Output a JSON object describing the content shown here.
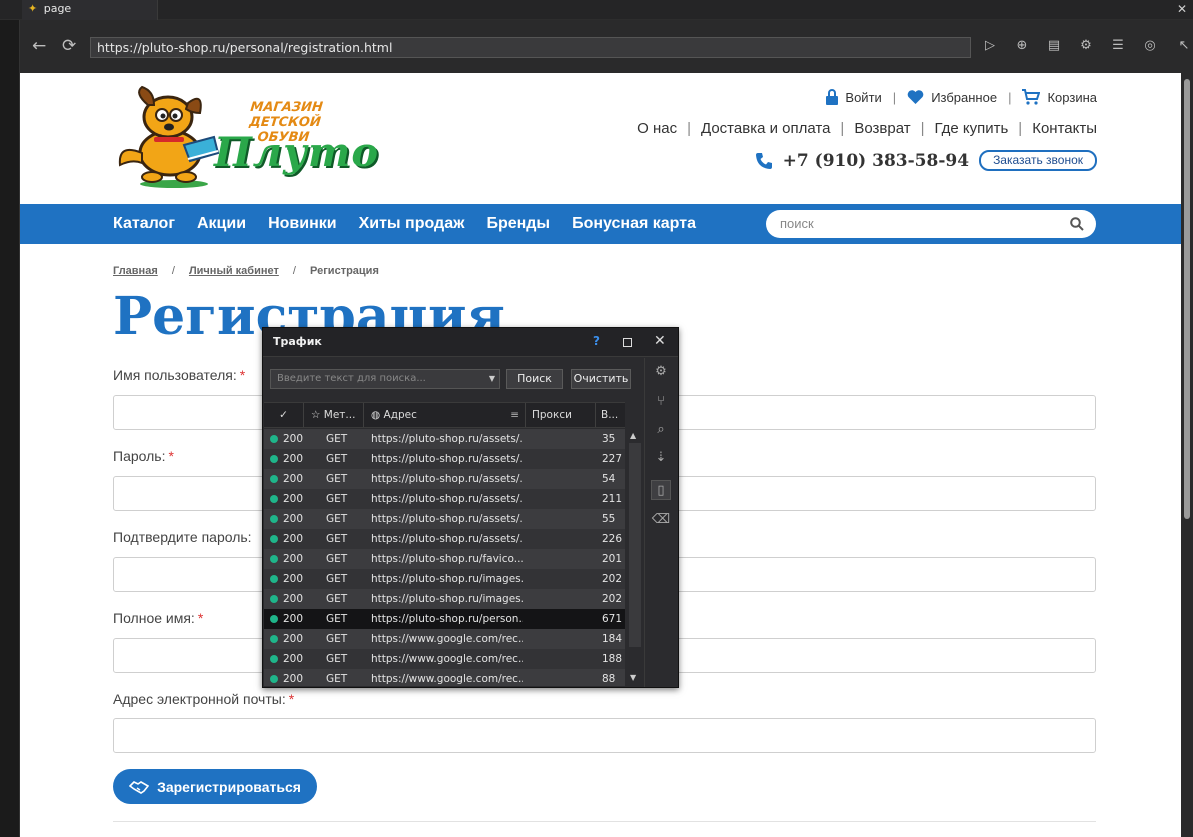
{
  "browser": {
    "tab_title": "page",
    "url": "https://pluto-shop.ru/personal/registration.html"
  },
  "site": {
    "logo_caption": "МАГАЗИН ДЕТСКОЙ ОБУВИ",
    "logo_brand": "Плуто",
    "top_links": {
      "login": "Войти",
      "favorites": "Избранное",
      "cart": "Корзина"
    },
    "menu": [
      "О нас",
      "Доставка и оплата",
      "Возврат",
      "Где купить",
      "Контакты"
    ],
    "phone": "+7 (910) 383-58-94",
    "callback": "Заказать звонок",
    "nav": [
      "Каталог",
      "Акции",
      "Новинки",
      "Хиты продаж",
      "Бренды",
      "Бонусная карта"
    ],
    "search_placeholder": "поиск",
    "colors": {
      "brand_blue": "#1f72c2",
      "required": "#dd3333"
    }
  },
  "breadcrumbs": {
    "home": "Главная",
    "cabinet": "Личный кабинет",
    "current": "Регистрация",
    "sep": "/"
  },
  "heading": "Регистрация",
  "form": {
    "username_label": "Имя пользователя:",
    "password_label": "Пароль:",
    "confirm_label": "Подтвердите пароль:",
    "fullname_label": "Полное имя:",
    "email_label": "Адрес электронной почты:",
    "required_mark": "*",
    "submit": "Зарегистрироваться"
  },
  "traffic": {
    "title": "Трафик",
    "help": "?",
    "search_placeholder": "Введите текст для поиска...",
    "search_btn": "Поиск",
    "clear_btn": "Очистить",
    "columns": {
      "method": "Мет...",
      "address": "Адрес",
      "proxy": "Прокси",
      "size": "В..."
    },
    "rows": [
      {
        "status": "200",
        "method": "GET",
        "url": "https://pluto-shop.ru/assets/...",
        "size": "35"
      },
      {
        "status": "200",
        "method": "GET",
        "url": "https://pluto-shop.ru/assets/...",
        "size": "227"
      },
      {
        "status": "200",
        "method": "GET",
        "url": "https://pluto-shop.ru/assets/...",
        "size": "54"
      },
      {
        "status": "200",
        "method": "GET",
        "url": "https://pluto-shop.ru/assets/...",
        "size": "211"
      },
      {
        "status": "200",
        "method": "GET",
        "url": "https://pluto-shop.ru/assets/...",
        "size": "55"
      },
      {
        "status": "200",
        "method": "GET",
        "url": "https://pluto-shop.ru/assets/...",
        "size": "226"
      },
      {
        "status": "200",
        "method": "GET",
        "url": "https://pluto-shop.ru/favico...",
        "size": "201"
      },
      {
        "status": "200",
        "method": "GET",
        "url": "https://pluto-shop.ru/images...",
        "size": "202"
      },
      {
        "status": "200",
        "method": "GET",
        "url": "https://pluto-shop.ru/images...",
        "size": "202"
      },
      {
        "status": "200",
        "method": "GET",
        "url": "https://pluto-shop.ru/person...",
        "size": "671",
        "selected": true
      },
      {
        "status": "200",
        "method": "GET",
        "url": "https://www.google.com/rec...",
        "size": "184"
      },
      {
        "status": "200",
        "method": "GET",
        "url": "https://www.google.com/rec...",
        "size": "188"
      },
      {
        "status": "200",
        "method": "GET",
        "url": "https://www.google.com/rec...",
        "size": "88"
      }
    ]
  }
}
